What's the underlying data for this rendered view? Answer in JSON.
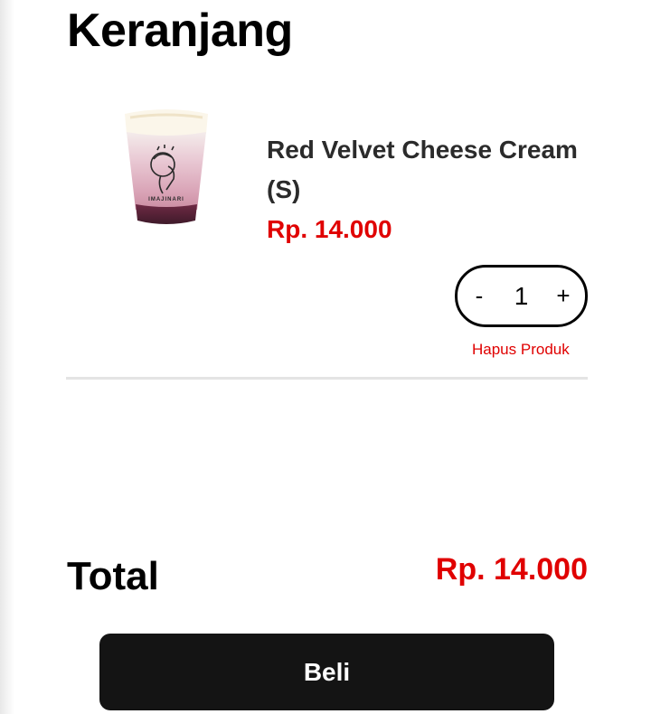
{
  "cart": {
    "title": "Keranjang",
    "items": [
      {
        "name": "Red Velvet Cheese Cream (S)",
        "price": "Rp. 14.000",
        "quantity": "1",
        "decrement_label": "-",
        "increment_label": "+",
        "remove_label": "Hapus Produk",
        "image_brand_text": "IMAJINARI"
      }
    ]
  },
  "summary": {
    "total_label": "Total",
    "total_value": "Rp. 14.000"
  },
  "actions": {
    "buy_label": "Beli"
  },
  "colors": {
    "accent_red": "#e00000",
    "button_dark": "#141414",
    "divider": "#e4e4e4"
  }
}
